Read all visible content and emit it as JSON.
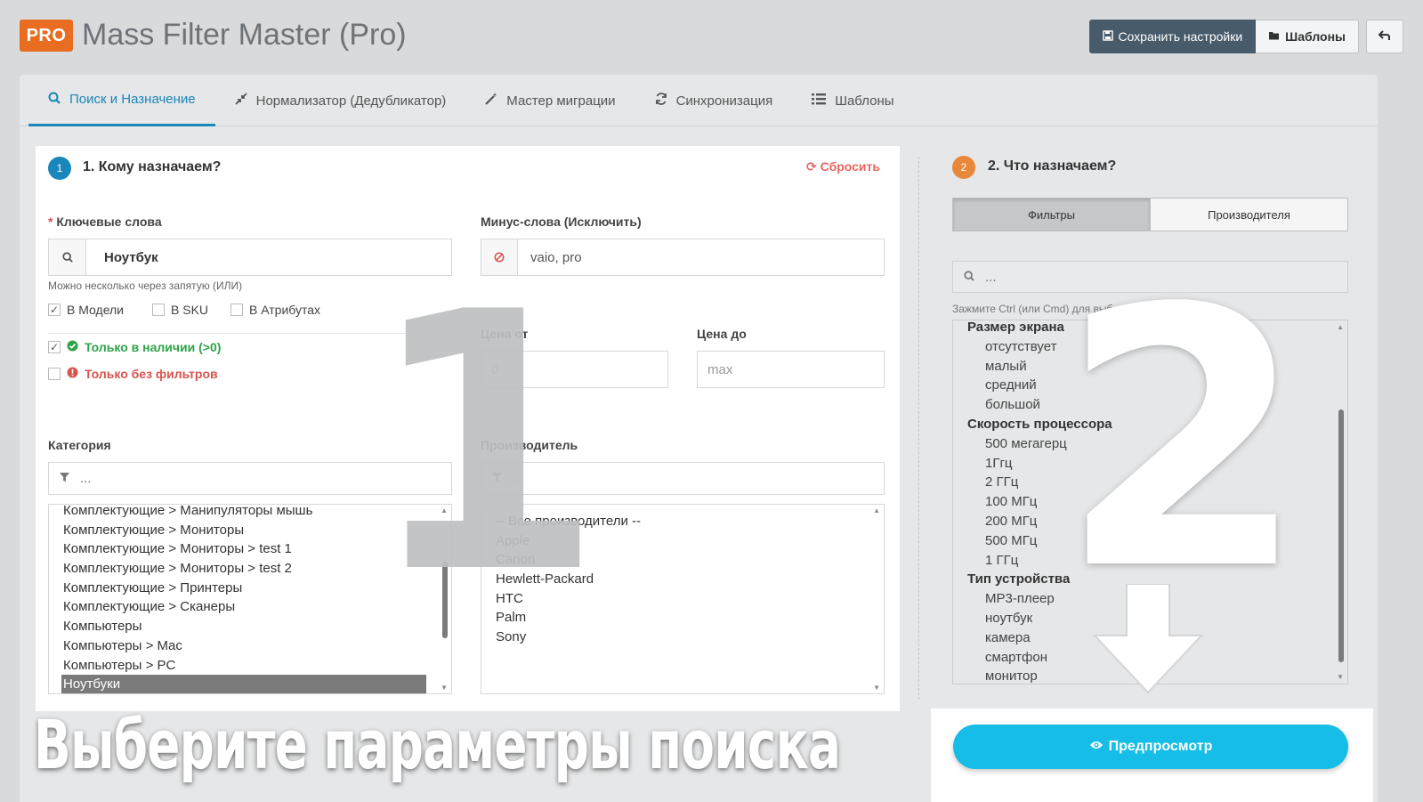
{
  "header": {
    "badge": "PRO",
    "title": "Mass Filter Master (Pro)",
    "save_label": "Сохранить настройки",
    "templates_label": "Шаблоны",
    "back_icon": "undo-icon"
  },
  "tabs": [
    {
      "label": "Поиск и Назначение",
      "icon": "search-icon",
      "active": true
    },
    {
      "label": "Нормализатор (Дедубликатор)",
      "icon": "compress-icon"
    },
    {
      "label": "Мастер миграции",
      "icon": "magic-wand-icon"
    },
    {
      "label": "Синхронизация",
      "icon": "refresh-icon"
    },
    {
      "label": "Шаблоны",
      "icon": "list-icon"
    }
  ],
  "left": {
    "step": "1",
    "title": "1. Кому назначаем?",
    "reset": "Сбросить",
    "keywords_label": "Ключевые слова",
    "keywords_value": "Ноутбук",
    "keywords_hint": "Можно несколько через запятую (ИЛИ)",
    "minus_label": "Минус-слова (Исключить)",
    "minus_value": "vaio, pro",
    "checks": {
      "model": "В Модели",
      "sku": "В SKU",
      "attrs": "В Атрибутах"
    },
    "in_stock": "Только в наличии (>0)",
    "no_filters": "Только без фильтров",
    "price_from_label": "Цена от",
    "price_from_placeholder": "0",
    "price_to_label": "Цена до",
    "price_to_placeholder": "max",
    "category_label": "Категория",
    "category_filter_placeholder": "...",
    "categories": [
      "Комплектующие  >  Манипуляторы мышь",
      "Комплектующие  >  Мониторы",
      "Комплектующие  >  Мониторы  >  test 1",
      "Комплектующие  >  Мониторы  >  test 2",
      "Комплектующие  >  Принтеры",
      "Комплектующие  >  Сканеры",
      "Компьютеры",
      "Компьютеры  >  Mac",
      "Компьютеры  >  PC",
      "Ноутбуки"
    ],
    "manufacturer_label": "Производитель",
    "manufacturer_filter_placeholder": "...",
    "manufacturers": [
      "-- Все производители --",
      "Apple",
      "Canon",
      "Hewlett-Packard",
      "HTC",
      "Palm",
      "Sony"
    ]
  },
  "right": {
    "step": "2",
    "title": "2. Что назначаем?",
    "seg_filters": "Фильтры",
    "seg_manufacturers": "Производителя",
    "search_placeholder": "...",
    "hint": "Зажмите Ctrl (или Cmd) для выбора сразу нескольких",
    "groups": [
      {
        "name": "Размер экрана",
        "options": [
          "отсутствует",
          "малый",
          "средний",
          "большой"
        ]
      },
      {
        "name": "Скорость процессора",
        "options": [
          "500 мегагерц",
          "1Ггц",
          "2 ГГц",
          "100 МГц",
          "200 МГц",
          "500 МГц",
          "1 ГГц"
        ]
      },
      {
        "name": "Тип устройства",
        "options": [
          "MP3-плеер",
          "ноутбук",
          "камера",
          "смартфон",
          "монитор"
        ]
      }
    ],
    "preview": "Предпросмотр"
  },
  "overlay": {
    "num1": "1",
    "num2": "2",
    "caption": "Выберите параметры поиска"
  },
  "colors": {
    "accent": "#1a86b9",
    "pro": "#e96d21",
    "preview": "#16bde6",
    "danger": "#d9534f",
    "success": "#2ea34a"
  }
}
